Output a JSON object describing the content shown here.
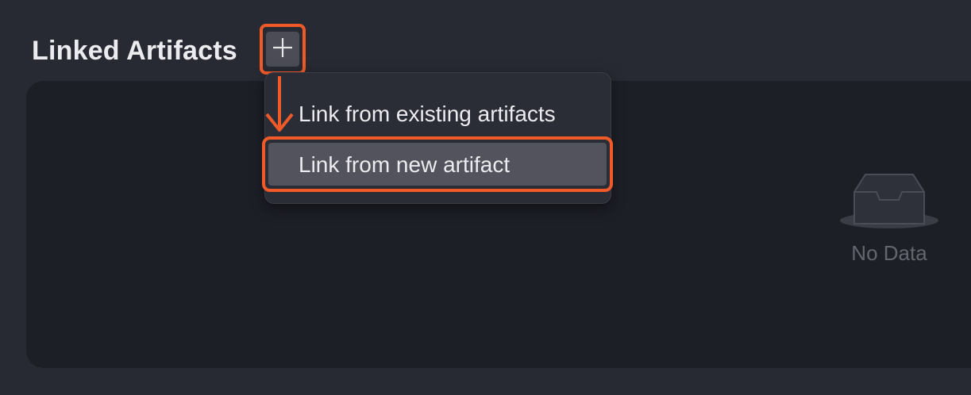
{
  "section": {
    "title": "Linked Artifacts",
    "add_icon": "plus-icon"
  },
  "dropdown": {
    "items": [
      {
        "label": "Link from existing artifacts",
        "highlighted": false
      },
      {
        "label": "Link from new artifact",
        "highlighted": true
      }
    ]
  },
  "empty_state": {
    "icon": "inbox-icon",
    "label": "No Data"
  },
  "annotation": {
    "highlight_color": "#f05a28",
    "arrow_icon": "arrow-down-icon"
  }
}
